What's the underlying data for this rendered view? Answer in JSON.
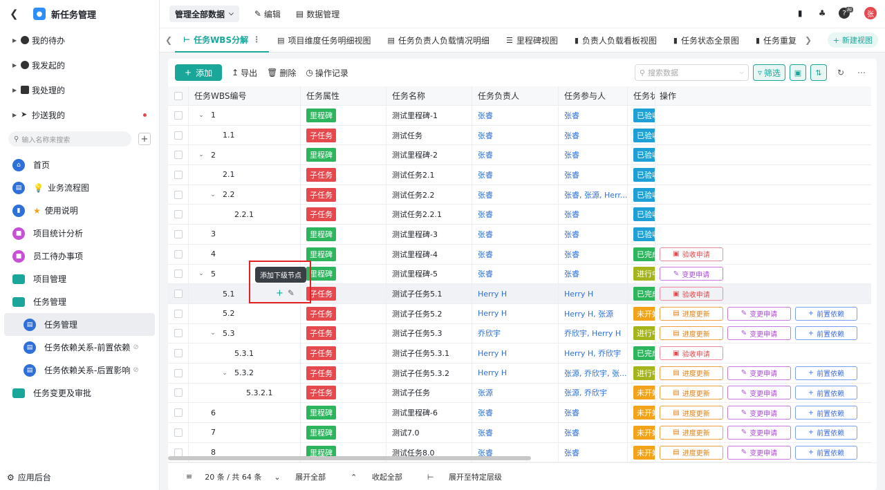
{
  "app": {
    "title": "新任务管理"
  },
  "sidebar": {
    "groups": [
      {
        "label": "我的待办"
      },
      {
        "label": "我发起的"
      },
      {
        "label": "我处理的"
      },
      {
        "label": "抄送我的"
      }
    ],
    "search_placeholder": "输入名称来搜索",
    "nav": [
      {
        "label": "首页"
      },
      {
        "label": "业务流程图"
      },
      {
        "label": "使用说明"
      },
      {
        "label": "项目统计分析"
      },
      {
        "label": "员工待办事项"
      },
      {
        "label": "项目管理"
      },
      {
        "label": "任务管理"
      },
      {
        "label": "任务管理"
      },
      {
        "label": "任务依赖关系-前置依赖"
      },
      {
        "label": "任务依赖关系-后置影响"
      },
      {
        "label": "任务变更及审批"
      }
    ],
    "footer_label": "应用后台"
  },
  "topbar": {
    "dropdown": "管理全部数据",
    "edit": "编辑",
    "data_manage": "数据管理",
    "avatar": "张",
    "ai_badge": "AI"
  },
  "tabs": [
    {
      "label": "任务WBS分解"
    },
    {
      "label": "项目维度任务明细视图"
    },
    {
      "label": "任务负责人负载情况明细"
    },
    {
      "label": "里程碑视图"
    },
    {
      "label": "负责人负载看板视图"
    },
    {
      "label": "任务状态全景图"
    },
    {
      "label": "任务重复"
    }
  ],
  "new_view": "新建视图",
  "toolbar": {
    "add": "添加",
    "export": "导出",
    "delete": "删除",
    "log": "操作记录",
    "search_placeholder": "搜索数据",
    "filter": "筛选"
  },
  "columns": [
    "任务WBS编号",
    "任务属性",
    "任务名称",
    "任务负责人",
    "任务参与人",
    "任务状",
    "操作"
  ],
  "colors": {
    "milestone": "#2db55d",
    "subtask": "#e5484d",
    "accepted": "#1e9fd6",
    "done": "#2db55d",
    "inprogress": "#a3b51a",
    "notstarted": "#f2a31a",
    "accent": "#1aa79a"
  },
  "ops": {
    "accept": "验收申请",
    "change": "变更申请",
    "progress": "进度更新",
    "predep": "前置依赖"
  },
  "rows": [
    {
      "wbs": "1",
      "level": 0,
      "exp": true,
      "attr": "里程碑",
      "name": "测试里程碑-1",
      "owner": "张睿",
      "part": "张睿",
      "status": "已验收",
      "ops": []
    },
    {
      "wbs": "1.1",
      "level": 1,
      "exp": false,
      "attr": "子任务",
      "name": "测试任务",
      "owner": "张睿",
      "part": "张睿",
      "status": "已验收",
      "ops": []
    },
    {
      "wbs": "2",
      "level": 0,
      "exp": true,
      "attr": "里程碑",
      "name": "测试里程碑-2",
      "owner": "张睿",
      "part": "张睿",
      "status": "已验收",
      "ops": []
    },
    {
      "wbs": "2.1",
      "level": 1,
      "exp": false,
      "attr": "子任务",
      "name": "测试任务2.1",
      "owner": "张睿",
      "part": "张睿",
      "status": "已验收",
      "ops": []
    },
    {
      "wbs": "2.2",
      "level": 1,
      "exp": true,
      "attr": "子任务",
      "name": "测试任务2.2",
      "owner": "张睿",
      "part": "张睿, 张源, Herr...",
      "status": "已验收",
      "ops": []
    },
    {
      "wbs": "2.2.1",
      "level": 2,
      "exp": false,
      "attr": "子任务",
      "name": "测试任务2.2.1",
      "owner": "张睿",
      "part": "张睿",
      "status": "已验收",
      "ops": []
    },
    {
      "wbs": "3",
      "level": 0,
      "exp": false,
      "attr": "里程碑",
      "name": "测试里程碑-3",
      "owner": "张睿",
      "part": "张睿",
      "status": "已验收",
      "ops": []
    },
    {
      "wbs": "4",
      "level": 0,
      "exp": false,
      "attr": "里程碑",
      "name": "测试里程碑-4",
      "owner": "张睿",
      "part": "张睿",
      "status": "已完成",
      "ops": [
        "accept"
      ]
    },
    {
      "wbs": "5",
      "level": 0,
      "exp": true,
      "attr": "里程碑",
      "name": "测试里程碑-5",
      "owner": "张睿",
      "part": "张睿",
      "status": "进行中",
      "ops": [
        "change"
      ]
    },
    {
      "wbs": "5.1",
      "level": 1,
      "exp": false,
      "attr": "子任务",
      "name": "测试子任务5.1",
      "owner": "Herry H",
      "part": "Herry H",
      "status": "已完成",
      "ops": [
        "accept"
      ]
    },
    {
      "wbs": "5.2",
      "level": 1,
      "exp": false,
      "attr": "子任务",
      "name": "测试子任务5.2",
      "owner": "Herry H",
      "part": "Herry H, 张源",
      "status": "未开始",
      "ops": [
        "progress",
        "change",
        "predep"
      ]
    },
    {
      "wbs": "5.3",
      "level": 1,
      "exp": true,
      "attr": "子任务",
      "name": "测试子任务5.3",
      "owner": "乔欣宇",
      "part": "乔欣宇, Herry H",
      "status": "进行中",
      "ops": [
        "progress",
        "change",
        "predep"
      ]
    },
    {
      "wbs": "5.3.1",
      "level": 2,
      "exp": false,
      "attr": "子任务",
      "name": "测试子任务5.3.1",
      "owner": "Herry H",
      "part": "Herry H, 乔欣宇",
      "status": "已完成",
      "ops": [
        "accept"
      ]
    },
    {
      "wbs": "5.3.2",
      "level": 2,
      "exp": true,
      "attr": "子任务",
      "name": "测试子任务5.3.2",
      "owner": "Herry H",
      "part": "张源, 乔欣宇, 张...",
      "status": "进行中",
      "ops": [
        "progress",
        "change",
        "predep"
      ]
    },
    {
      "wbs": "5.3.2.1",
      "level": 3,
      "exp": false,
      "attr": "子任务",
      "name": "测试子任务",
      "owner": "张源",
      "part": "张源, 乔欣宇",
      "status": "未开始",
      "ops": [
        "progress",
        "change",
        "predep"
      ]
    },
    {
      "wbs": "6",
      "level": 0,
      "exp": false,
      "attr": "里程碑",
      "name": "测试里程碑-6",
      "owner": "张睿",
      "part": "张睿",
      "status": "未开始",
      "ops": [
        "progress",
        "change",
        "predep"
      ]
    },
    {
      "wbs": "7",
      "level": 0,
      "exp": false,
      "attr": "里程碑",
      "name": "测试7.0",
      "owner": "张睿",
      "part": "张睿",
      "status": "未开始",
      "ops": [
        "progress",
        "change",
        "predep"
      ]
    },
    {
      "wbs": "8",
      "level": 0,
      "exp": false,
      "attr": "里程碑",
      "name": "测试任务8.0",
      "owner": "张睿",
      "part": "张睿",
      "status": "未开始",
      "ops": [
        "progress",
        "change",
        "predep"
      ]
    }
  ],
  "tooltip": "添加下级节点",
  "footer": {
    "count": "20 条 / 共 64 条",
    "expand_all": "展开全部",
    "collapse_all": "收起全部",
    "expand_level": "展开至特定层级"
  }
}
